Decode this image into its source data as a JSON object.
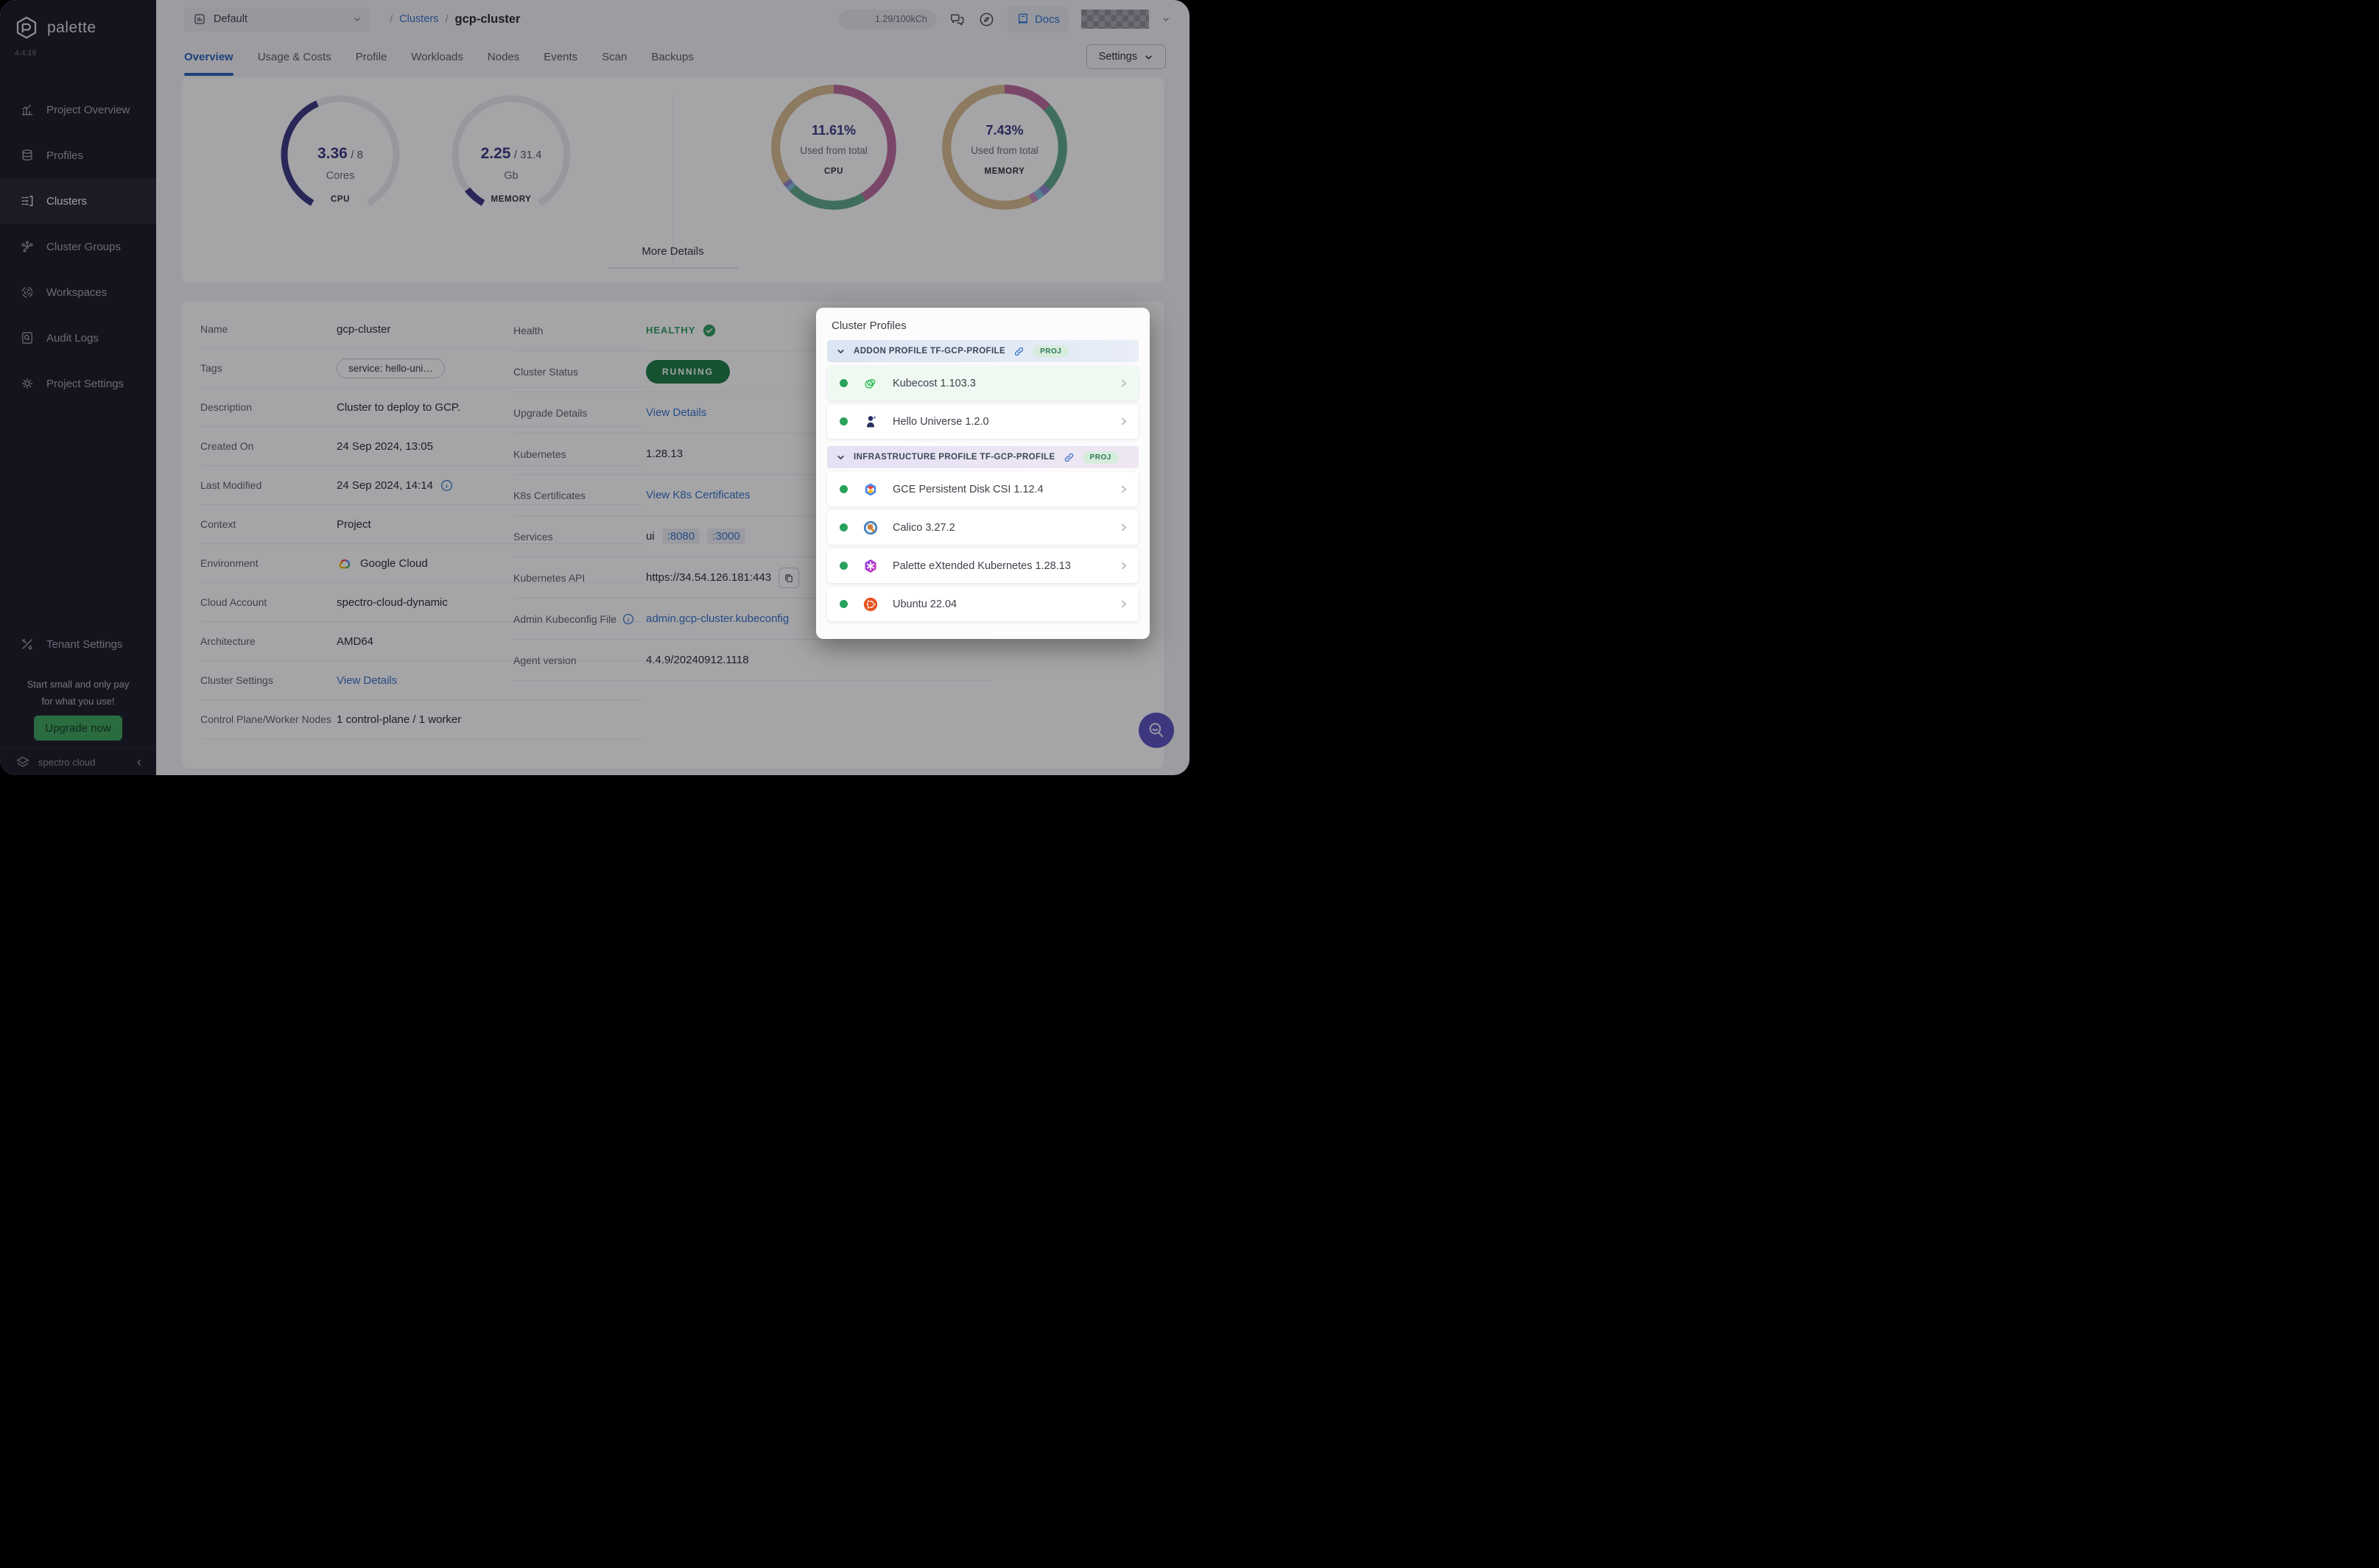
{
  "sidebar": {
    "logo_text": "palette",
    "version": "4.4.19",
    "items": [
      {
        "label": "Project Overview",
        "icon": "chart-overview-icon",
        "active": false
      },
      {
        "label": "Profiles",
        "icon": "layers-icon",
        "active": false
      },
      {
        "label": "Clusters",
        "icon": "clusters-list-icon",
        "active": true
      },
      {
        "label": "Cluster Groups",
        "icon": "node-graph-icon",
        "active": false
      },
      {
        "label": "Workspaces",
        "icon": "workspaces-icon",
        "active": false
      },
      {
        "label": "Audit Logs",
        "icon": "audit-search-icon",
        "active": false
      },
      {
        "label": "Project Settings",
        "icon": "gear-icon",
        "active": false
      }
    ],
    "tenant_settings_label": "Tenant Settings",
    "promo_line1": "Start small and only pay",
    "promo_line2": "for what you use!",
    "upgrade_label": "Upgrade now",
    "brand": "spectro cloud"
  },
  "header": {
    "project_selector": "Default",
    "breadcrumb": {
      "sep": "/",
      "section": "Clusters",
      "current": "gcp-cluster"
    },
    "usage_badge": "1.29/100kCh",
    "docs_label": "Docs"
  },
  "tabs": {
    "items": [
      "Overview",
      "Usage & Costs",
      "Profile",
      "Workloads",
      "Nodes",
      "Events",
      "Scan",
      "Backups"
    ],
    "active": "Overview",
    "settings_label": "Settings"
  },
  "overview": {
    "cpu_gauge": {
      "value": "3.36",
      "total": "8",
      "unit": "Cores",
      "caption": "CPU",
      "arc_color": "#3c3883",
      "track_color": "#e9e9f0"
    },
    "memory_gauge": {
      "value": "2.25",
      "total": "31.4",
      "unit": "Gb",
      "caption": "MEMORY",
      "arc_color": "#3c3883",
      "track_color": "#e9e9f0"
    },
    "cpu_ring": {
      "percent": "11.61%",
      "subtitle": "Used from total",
      "caption": "CPU",
      "segments": [
        {
          "color": "#bd6a9e",
          "to": 41.5
        },
        {
          "color": "#5fa98a",
          "to": 62.5
        },
        {
          "color": "#85bede",
          "to": 63.7
        },
        {
          "color": "#9187d2",
          "to": 65
        },
        {
          "color": "#d8bb90",
          "to": 100
        }
      ]
    },
    "memory_ring": {
      "percent": "7.43%",
      "subtitle": "Used from total",
      "caption": "MEMORY",
      "segments": [
        {
          "color": "#bd6a9e",
          "to": 13
        },
        {
          "color": "#5fa98a",
          "to": 37
        },
        {
          "color": "#9187d2",
          "to": 39
        },
        {
          "color": "#85bede",
          "to": 41
        },
        {
          "color": "#cf8cc0",
          "to": 42.5
        },
        {
          "color": "#d8bb90",
          "to": 100
        }
      ]
    },
    "more_details_label": "More Details"
  },
  "details": {
    "left": [
      {
        "label": "Name",
        "value": "gcp-cluster"
      },
      {
        "label": "Tags",
        "value": "service: hello-uni…"
      },
      {
        "label": "Description",
        "value": "Cluster to deploy to GCP."
      },
      {
        "label": "Created On",
        "value": "24 Sep 2024, 13:05"
      },
      {
        "label": "Last Modified",
        "value": "24 Sep 2024, 14:14"
      },
      {
        "label": "Context",
        "value": "Project"
      },
      {
        "label": "Environment",
        "value": "Google Cloud"
      },
      {
        "label": "Cloud Account",
        "value": "spectro-cloud-dynamic"
      },
      {
        "label": "Architecture",
        "value": "AMD64"
      },
      {
        "label": "Cluster Settings",
        "value": "View Details"
      },
      {
        "label": "Control Plane/Worker Nodes",
        "value": "1 control-plane / 1 worker"
      }
    ],
    "right": [
      {
        "label": "Health",
        "value": "HEALTHY"
      },
      {
        "label": "Cluster Status",
        "value": "RUNNING"
      },
      {
        "label": "Upgrade Details",
        "value": "View Details"
      },
      {
        "label": "Kubernetes",
        "value": "1.28.13"
      },
      {
        "label": "K8s Certificates",
        "value": "View K8s Certificates"
      },
      {
        "label": "Services",
        "prefix": "ui",
        "ports": [
          ":8080",
          ":3000"
        ]
      },
      {
        "label": "Kubernetes API",
        "value": "https://34.54.126.181:443"
      },
      {
        "label": "Admin Kubeconfig File",
        "value": "admin.gcp-cluster.kubeconfig"
      },
      {
        "label": "Agent version",
        "value": "4.4.9/20240912.1118"
      }
    ]
  },
  "cluster_profiles": {
    "title": "Cluster Profiles",
    "sections": [
      {
        "header": "ADDON PROFILE TF-GCP-PROFILE",
        "badge": "PROJ",
        "items": [
          {
            "name": "Kubecost 1.103.3",
            "logo": "kubecost-logo"
          },
          {
            "name": "Hello Universe 1.2.0",
            "logo": "hello-universe-logo"
          }
        ]
      },
      {
        "header": "INFRASTRUCTURE PROFILE TF-GCP-PROFILE",
        "badge": "PROJ",
        "items": [
          {
            "name": "GCE Persistent Disk CSI 1.12.4",
            "logo": "gce-disk-logo"
          },
          {
            "name": "Calico 3.27.2",
            "logo": "calico-logo"
          },
          {
            "name": "Palette eXtended Kubernetes 1.28.13",
            "logo": "pxk-logo"
          },
          {
            "name": "Ubuntu 22.04",
            "logo": "ubuntu-logo"
          }
        ]
      }
    ]
  },
  "colors": {
    "accent_blue": "#2e6fd0",
    "link_blue": "#3571c9",
    "healthy_green": "#2f9e5f",
    "running_green": "#1e7c41",
    "gauge_indigo": "#3c3883",
    "upgrade_green": "#3fa45c",
    "fab_indigo": "#5b51c0"
  }
}
